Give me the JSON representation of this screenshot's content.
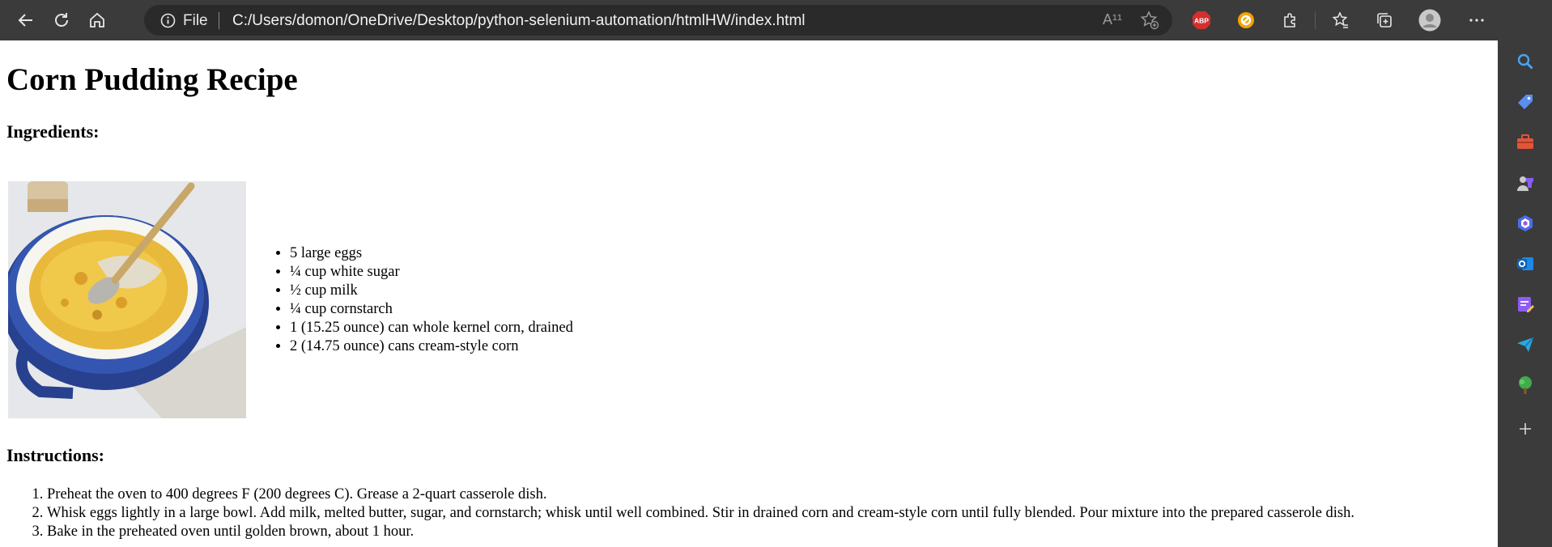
{
  "browser": {
    "address": {
      "scheme": "File",
      "url": "C:/Users/domon/OneDrive/Desktop/python-selenium-automation/htmlHW/index.html"
    },
    "read_aloud": "A¹¹",
    "adblock_label": "ABP"
  },
  "recipe": {
    "title": "Corn Pudding Recipe",
    "ingredients_heading": "Ingredients:",
    "ingredients": [
      "5 large eggs",
      "¼ cup white sugar",
      "½ cup milk",
      "¼ cup cornstarch",
      "1 (15.25 ounce) can whole kernel corn, drained",
      "2 (14.75 ounce) cans cream-style corn"
    ],
    "instructions_heading": "Instructions:",
    "instructions": [
      "Preheat the oven to 400 degrees F (200 degrees C). Grease a 2-quart casserole dish.",
      "Whisk eggs lightly in a large bowl. Add milk, melted butter, sugar, and cornstarch; whisk until well combined. Stir in drained corn and cream-style corn until fully blended. Pour mixture into the prepared casserole dish.",
      "Bake in the preheated oven until golden brown, about 1 hour."
    ]
  },
  "icons": {
    "toolbar": [
      "back-icon",
      "refresh-icon",
      "home-icon",
      "info-icon",
      "read-aloud-icon",
      "add-favorite-icon",
      "adblock-icon",
      "honey-extension-icon",
      "extensions-icon",
      "favorites-icon",
      "collections-icon",
      "profile-icon",
      "more-icon",
      "bing-chat-icon"
    ],
    "sidebar": [
      "search-icon",
      "shopping-icon",
      "tools-icon",
      "games-icon",
      "copilot-icon",
      "outlook-icon",
      "drop-icon",
      "send-icon",
      "tree-icon",
      "add-icon"
    ]
  },
  "colors": {
    "chrome_bg": "#3b3b3b",
    "address_bg": "#2a2a2a",
    "page_bg": "#ffffff",
    "abp_red": "#d32f2f"
  }
}
